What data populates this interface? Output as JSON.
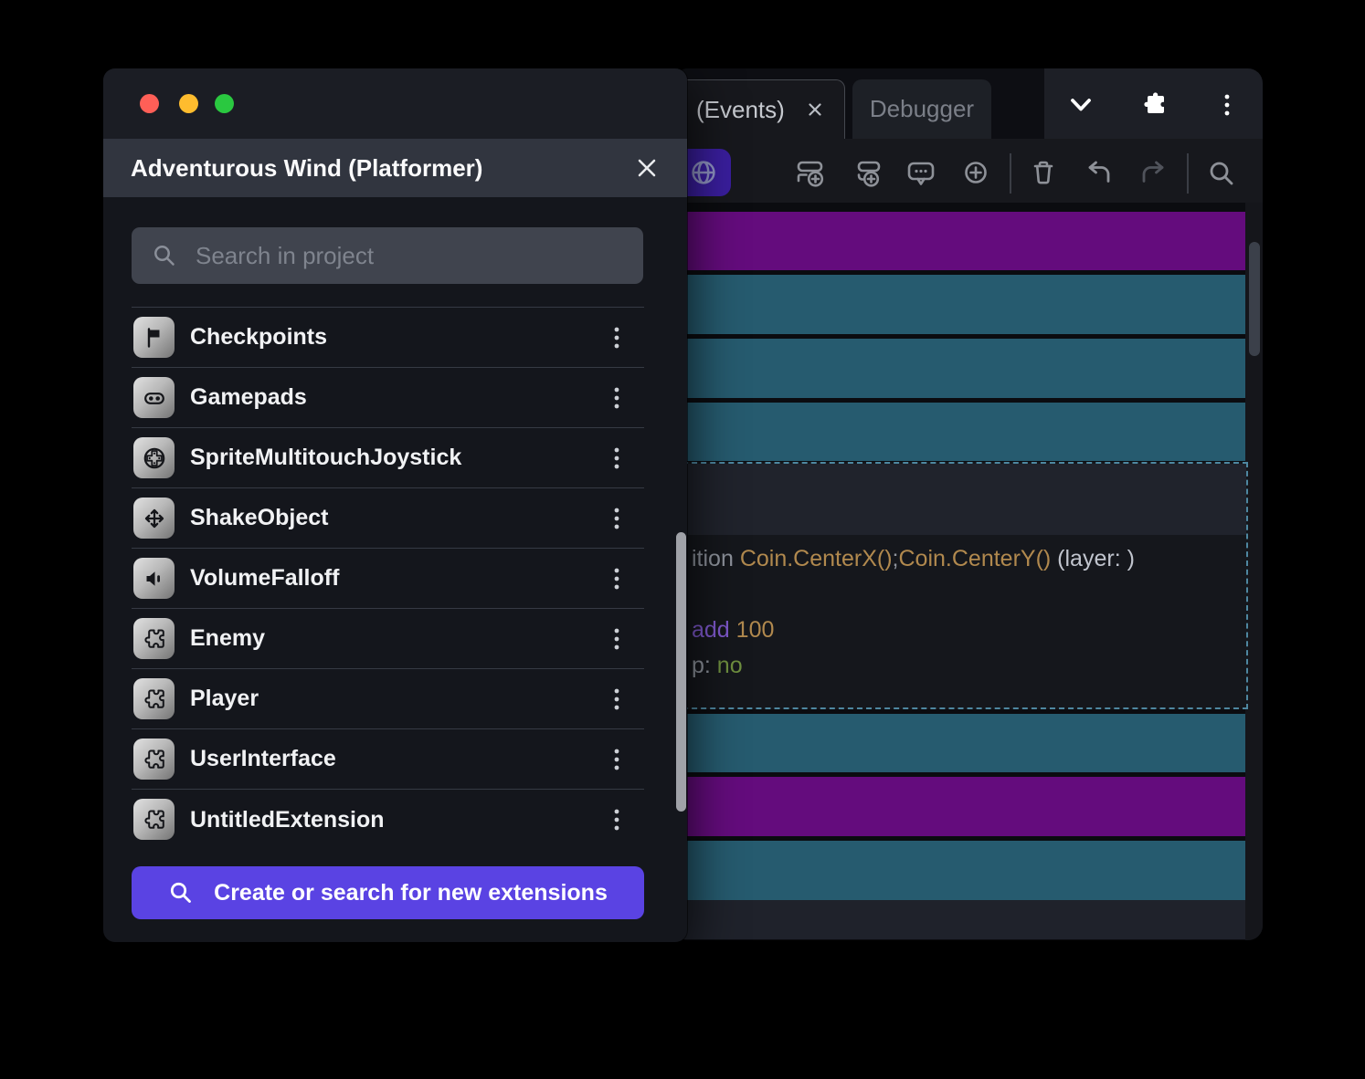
{
  "dialog": {
    "title": "Adventurous Wind (Platformer)",
    "window_controls": [
      "close-traffic-light",
      "minimize-traffic-light",
      "zoom-traffic-light"
    ],
    "close_icon": "close-icon",
    "search_placeholder": "Search in project",
    "items": [
      {
        "label": "Checkpoints",
        "icon": "flag-icon"
      },
      {
        "label": "Gamepads",
        "icon": "gamepad-icon"
      },
      {
        "label": "SpriteMultitouchJoystick",
        "icon": "joystick-icon"
      },
      {
        "label": "ShakeObject",
        "icon": "move-icon"
      },
      {
        "label": "VolumeFalloff",
        "icon": "speaker-icon"
      },
      {
        "label": "Enemy",
        "icon": "puzzle-icon"
      },
      {
        "label": "Player",
        "icon": "puzzle-icon"
      },
      {
        "label": "UserInterface",
        "icon": "puzzle-icon"
      },
      {
        "label": "UntitledExtension",
        "icon": "puzzle-icon"
      }
    ],
    "item_menu_icon": "kebab-menu-icon",
    "create_button_label": "Create or search for new extensions"
  },
  "editor": {
    "tabs": [
      {
        "label": "(Events)",
        "closable": true,
        "active": true
      },
      {
        "label": "Debugger",
        "closable": false,
        "active": false
      }
    ],
    "tabbar_icons": [
      "chevron-down-icon",
      "extensions-icon",
      "kebab-menu-icon"
    ],
    "toolbar_icons": [
      "globe-icon",
      "add-event-icon",
      "add-subevent-icon",
      "add-comment-icon",
      "add-circle-icon",
      "trash-icon",
      "undo-icon",
      "redo-icon",
      "search-icon"
    ],
    "event_rows": [
      "purple",
      "teal",
      "teal",
      "teal",
      "selected",
      "teal",
      "purple",
      "teal"
    ],
    "selected_event_code": {
      "line1": [
        {
          "t": "ition ",
          "c": "gray"
        },
        {
          "t": "Coin.CenterX()",
          "c": "gold"
        },
        {
          "t": ";",
          "c": "gray"
        },
        {
          "t": "Coin.CenterY()",
          "c": "gold"
        },
        {
          "t": " (layer: )",
          "c": "light"
        }
      ],
      "line2": [
        {
          "t": "add ",
          "c": "purple"
        },
        {
          "t": "100",
          "c": "gold"
        }
      ],
      "line3": [
        {
          "t": "p: ",
          "c": "gray"
        },
        {
          "t": "no",
          "c": "green"
        }
      ]
    },
    "colors": {
      "row_purple": "#640c7d",
      "row_teal": "#265b6f",
      "accent_indigo": "#3a1e9e",
      "button_violet": "#5a43e3",
      "selection_dash": "#4e87a0"
    }
  }
}
